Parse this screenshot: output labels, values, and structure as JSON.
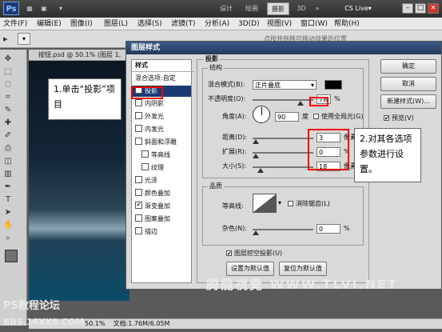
{
  "topbar": {
    "buttons": [
      "设计",
      "绘画",
      "摄影",
      "3D"
    ],
    "active_button": "摄影",
    "more": "»",
    "cslive": "CS Live▾"
  },
  "menu": [
    "文件(F)",
    "编辑(E)",
    "图像(I)",
    "图层(L)",
    "选择(S)",
    "滤镜(T)",
    "分析(A)",
    "3D(D)",
    "视图(V)",
    "窗口(W)",
    "帮助(H)"
  ],
  "document": {
    "tab_title": "按钮.psd @ 50.1% (图层 1,",
    "status_zoom": "50.1%",
    "status_doc": "文档:1.76M/6.05M",
    "canvas_hint": "点按并拖移可移动效果的位置"
  },
  "dialog": {
    "title": "图层样式",
    "styles_header": "样式",
    "style_items": [
      {
        "label": "混合选项:自定",
        "checked": null,
        "selected": false
      },
      {
        "label": "投影",
        "checked": true,
        "selected": true
      },
      {
        "label": "内阴影",
        "checked": false,
        "selected": false
      },
      {
        "label": "外发光",
        "checked": false,
        "selected": false
      },
      {
        "label": "内发光",
        "checked": false,
        "selected": false
      },
      {
        "label": "斜面和浮雕",
        "checked": false,
        "selected": false
      },
      {
        "label": "等高线",
        "checked": false,
        "selected": false
      },
      {
        "label": "纹理",
        "checked": false,
        "selected": false
      },
      {
        "label": "光泽",
        "checked": false,
        "selected": false
      },
      {
        "label": "颜色叠加",
        "checked": false,
        "selected": false
      },
      {
        "label": "渐变叠加",
        "checked": true,
        "selected": false
      },
      {
        "label": "图案叠加",
        "checked": false,
        "selected": false
      },
      {
        "label": "描边",
        "checked": false,
        "selected": false
      }
    ],
    "section_title": "投影",
    "structure_title": "结构",
    "blend_mode_label": "混合模式(B):",
    "blend_mode_value": "正片叠底",
    "opacity_label": "不透明度(O):",
    "opacity_value": "78",
    "opacity_unit": "%",
    "angle_label": "角度(A):",
    "angle_value": "90",
    "angle_unit": "度",
    "global_light_label": "使用全局光(G)",
    "distance_label": "距离(D):",
    "distance_value": "3",
    "distance_unit": "像素",
    "spread_label": "扩展(R):",
    "spread_value": "0",
    "spread_unit": "%",
    "size_label": "大小(S):",
    "size_value": "18",
    "size_unit": "像素",
    "quality_title": "品质",
    "contour_label": "等高线:",
    "antialias_label": "消除锯齿(L)",
    "noise_label": "杂色(N):",
    "noise_value": "0",
    "noise_unit": "%",
    "knockout_label": "图层挖空投影(U)",
    "default_btn": "设置为默认值",
    "reset_btn": "复位为默认值",
    "ok_btn": "确定",
    "cancel_btn": "取消",
    "new_style_btn": "新建样式(W)...",
    "preview_label": "预览(V)",
    "shadow_color": "#000000"
  },
  "callouts": {
    "one": "1.单击“投影”项目",
    "two": "2.对其各选项参数进行设置。"
  },
  "watermark": {
    "tlvi": "腾龍視覺 WWW.TLVI.NET",
    "ps_bbs": "PS教程论坛",
    "bbs": "BBS.16XX8.COM"
  }
}
